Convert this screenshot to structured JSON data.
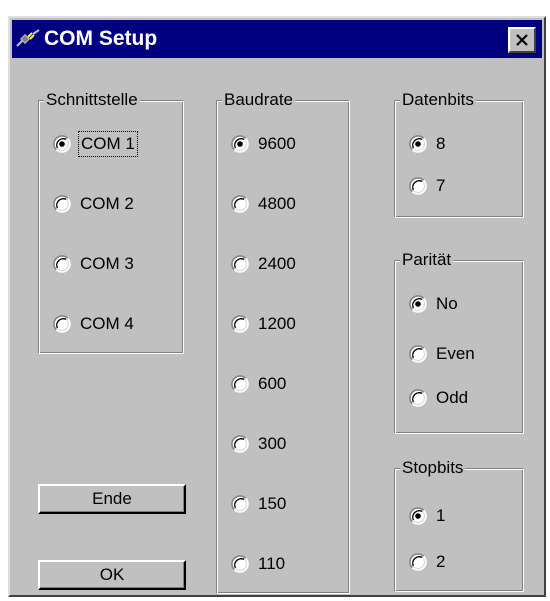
{
  "window": {
    "title": "COM Setup",
    "close_label": "✕"
  },
  "groups": {
    "schnittstelle": {
      "label": "Schnittstelle",
      "options": [
        "COM 1",
        "COM 2",
        "COM 3",
        "COM 4"
      ],
      "selected": "COM 1"
    },
    "baudrate": {
      "label": "Baudrate",
      "options": [
        "9600",
        "4800",
        "2400",
        "1200",
        "600",
        "300",
        "150",
        "110"
      ],
      "selected": "9600"
    },
    "datenbits": {
      "label": "Datenbits",
      "options": [
        "8",
        "7"
      ],
      "selected": "8"
    },
    "paritaet": {
      "label": "Parität",
      "options": [
        "No",
        "Even",
        "Odd"
      ],
      "selected": "No"
    },
    "stopbits": {
      "label": "Stopbits",
      "options": [
        "1",
        "2"
      ],
      "selected": "1"
    }
  },
  "buttons": {
    "ende_label": "Ende",
    "ok_label": "OK"
  },
  "icons": {
    "title_icon": "plug-cable-icon",
    "close": "close-icon"
  },
  "colors": {
    "titlebar": "#000080",
    "face": "#c0c0c0"
  }
}
